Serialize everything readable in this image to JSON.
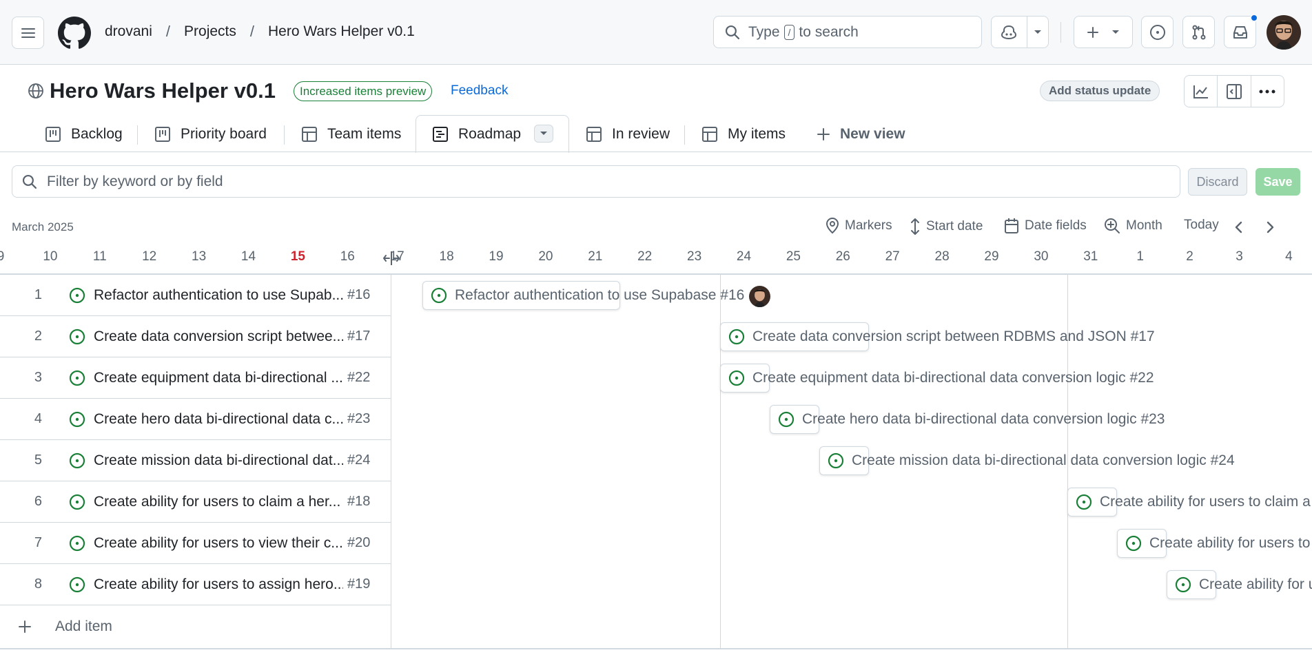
{
  "header": {
    "breadcrumbs": [
      "drovani",
      "Projects",
      "Hero Wars Helper v0.1"
    ],
    "search": {
      "before": "Type",
      "key": "/",
      "after": "to search"
    }
  },
  "project": {
    "title": "Hero Wars Helper v0.1",
    "preview_badge": "Increased items preview",
    "feedback": "Feedback",
    "status_button": "Add status update"
  },
  "tabs": [
    {
      "label": "Backlog",
      "icon": "board-icon"
    },
    {
      "label": "Priority board",
      "icon": "board-icon"
    },
    {
      "label": "Team items",
      "icon": "table-icon"
    },
    {
      "label": "Roadmap",
      "icon": "roadmap-icon",
      "active": true
    },
    {
      "label": "In review",
      "icon": "table-icon"
    },
    {
      "label": "My items",
      "icon": "table-icon"
    },
    {
      "label": "New view",
      "icon": "plus-icon"
    }
  ],
  "filter": {
    "placeholder": "Filter by keyword or by field",
    "discard": "Discard",
    "save": "Save"
  },
  "roadmap": {
    "month_label": "March 2025",
    "controls": {
      "markers": "Markers",
      "start_date": "Start date",
      "date_fields": "Date fields",
      "zoom": "Month",
      "today": "Today"
    },
    "days": [
      "9",
      "10",
      "11",
      "12",
      "13",
      "14",
      "15",
      "16",
      "17",
      "18",
      "19",
      "20",
      "21",
      "22",
      "23",
      "24",
      "25",
      "26",
      "27",
      "28",
      "29",
      "30",
      "31",
      "1",
      "2",
      "3",
      "4"
    ],
    "today_day": "15"
  },
  "items": [
    {
      "num": "1",
      "title": "Refactor authentication to use Supab...",
      "ref": "#16",
      "bar_label": "Refactor authentication to use Supabase #16"
    },
    {
      "num": "2",
      "title": "Create data conversion script betwee...",
      "ref": "#17",
      "bar_label": "Create data conversion script between RDBMS and JSON #17"
    },
    {
      "num": "3",
      "title": "Create equipment data bi-directional ...",
      "ref": "#22",
      "bar_label": "Create equipment data bi-directional data conversion logic #22"
    },
    {
      "num": "4",
      "title": "Create hero data bi-directional data c...",
      "ref": "#23",
      "bar_label": "Create hero data bi-directional data conversion logic #23"
    },
    {
      "num": "5",
      "title": "Create mission data bi-directional dat...",
      "ref": "#24",
      "bar_label": "Create mission data bi-directional data conversion logic #24"
    },
    {
      "num": "6",
      "title": "Create ability for users to claim a her...",
      "ref": "#18",
      "bar_label": "Create ability for users to claim a"
    },
    {
      "num": "7",
      "title": "Create ability for users to view their c...",
      "ref": "#20",
      "bar_label": "Create ability for users to"
    },
    {
      "num": "8",
      "title": "Create ability for users to assign hero...",
      "ref": "#19",
      "bar_label": "Create ability for u"
    }
  ],
  "add_item": "Add item",
  "colors": {
    "open_issue": "#1a7f37",
    "today": "#cf222e",
    "link": "#0969da",
    "save_disabled": "#95d8a6"
  }
}
